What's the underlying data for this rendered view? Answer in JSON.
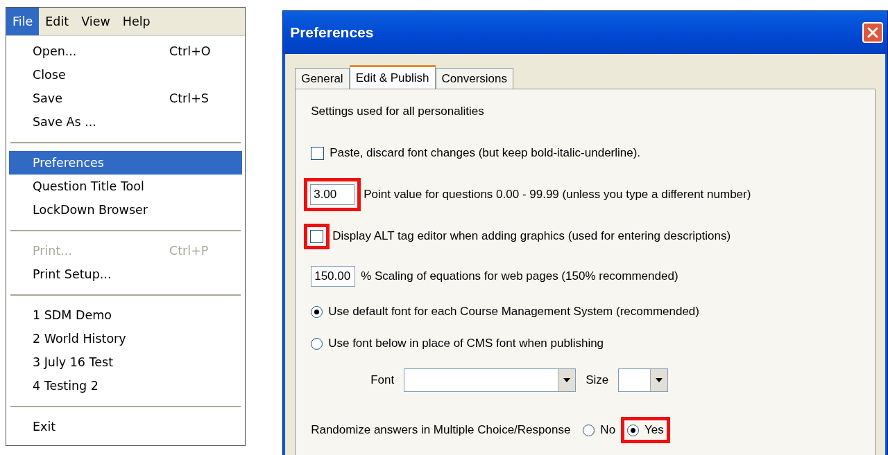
{
  "menu": {
    "bar": [
      {
        "label": "File",
        "selected": true
      },
      {
        "label": "Edit",
        "selected": false
      },
      {
        "label": "View",
        "selected": false
      },
      {
        "label": "Help",
        "selected": false
      }
    ],
    "items": [
      {
        "kind": "item",
        "label": "Open...",
        "shortcut": "Ctrl+O",
        "selected": false,
        "disabled": false
      },
      {
        "kind": "item",
        "label": "Close",
        "selected": false,
        "disabled": false
      },
      {
        "kind": "item",
        "label": "Save",
        "shortcut": "Ctrl+S",
        "selected": false,
        "disabled": false
      },
      {
        "kind": "item",
        "label": "Save As ...",
        "selected": false,
        "disabled": false
      },
      {
        "kind": "separator"
      },
      {
        "kind": "item",
        "label": "Preferences",
        "selected": true,
        "disabled": false
      },
      {
        "kind": "item",
        "label": "Question Title Tool",
        "selected": false,
        "disabled": false
      },
      {
        "kind": "item",
        "label": "LockDown Browser",
        "selected": false,
        "disabled": false
      },
      {
        "kind": "separator"
      },
      {
        "kind": "item",
        "label": "Print...",
        "shortcut": "Ctrl+P",
        "selected": false,
        "disabled": true
      },
      {
        "kind": "item",
        "label": "Print Setup...",
        "selected": false,
        "disabled": false
      },
      {
        "kind": "separator"
      },
      {
        "kind": "item",
        "label": "1 SDM Demo",
        "selected": false,
        "disabled": false
      },
      {
        "kind": "item",
        "label": "2 World History",
        "selected": false,
        "disabled": false
      },
      {
        "kind": "item",
        "label": "3 July 16 Test",
        "selected": false,
        "disabled": false
      },
      {
        "kind": "item",
        "label": "4 Testing 2",
        "selected": false,
        "disabled": false
      },
      {
        "kind": "separator"
      },
      {
        "kind": "item",
        "label": "Exit",
        "selected": false,
        "disabled": false
      }
    ]
  },
  "dialog": {
    "title": "Preferences",
    "tabs": [
      {
        "label": "General",
        "selected": false
      },
      {
        "label": "Edit & Publish",
        "selected": true
      },
      {
        "label": "Conversions",
        "selected": false
      }
    ],
    "heading": "Settings used for all personalities",
    "rows": [
      {
        "kind": "checkbox",
        "label": "Paste, discard font changes (but keep bold-italic-underline).",
        "checked": false,
        "highlighted": false
      },
      {
        "kind": "number",
        "value": "3.00",
        "label": "Point value for questions 0.00 - 99.99  (unless you type a different number)",
        "highlighted": true
      },
      {
        "kind": "checkbox",
        "label": "Display ALT tag editor when adding graphics (used for entering descriptions)",
        "checked": false,
        "highlighted": true
      },
      {
        "kind": "number",
        "value": "150.00",
        "label": "%  Scaling of equations for web pages (150% recommended)",
        "highlighted": false
      },
      {
        "kind": "radio",
        "label": "Use default font for each Course Management System (recommended)",
        "selected": true
      },
      {
        "kind": "radio",
        "label": "Use font below in place of CMS font when publishing",
        "selected": false
      },
      {
        "kind": "fontpicker",
        "font_label": "Font",
        "size_label": "Size"
      },
      {
        "kind": "choice",
        "label": "Randomize answers in Multiple Choice/Response",
        "options": [
          {
            "label": "No",
            "selected": false,
            "highlighted": false
          },
          {
            "label": "Yes",
            "selected": true,
            "highlighted": true
          }
        ]
      }
    ]
  }
}
